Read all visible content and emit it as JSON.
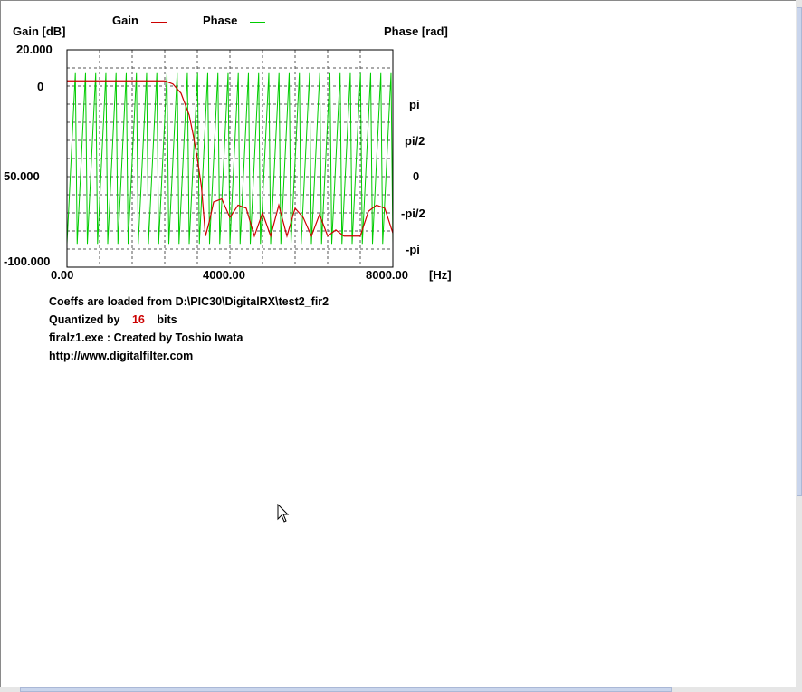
{
  "legend": {
    "gain_label": "Gain",
    "phase_label": "Phase",
    "gain_color": "#cc0000",
    "phase_color": "#00cc00"
  },
  "axes": {
    "left_title": "Gain [dB]",
    "right_title": "Phase [rad]",
    "left_ticks": [
      "20.000",
      "0",
      "50.000",
      "-100.000"
    ],
    "right_ticks": [
      "pi",
      "pi/2",
      "0",
      "-pi/2",
      "-pi"
    ],
    "x_ticks": [
      "0.00",
      "4000.00",
      "8000.00"
    ],
    "x_unit": "[Hz]"
  },
  "info": {
    "coeffs_line": "Coeffs are loaded from D:\\PIC30\\DigitalRX\\test2_fir2",
    "quantized_prefix": "Quantized by",
    "quantized_bits": "16",
    "quantized_suffix": "bits",
    "created_line": "firalz1.exe : Created by Toshio Iwata",
    "url_line": "http://www.digitalfilter.com"
  },
  "chart_data": {
    "type": "line",
    "x_range": [
      0,
      8000
    ],
    "x_unit": "Hz",
    "grid": true,
    "series": [
      {
        "name": "Gain",
        "color": "#cc0000",
        "x": [
          0,
          2400,
          2600,
          2800,
          3000,
          3100,
          3200,
          3300,
          3400,
          3500,
          3600,
          3800,
          4000,
          4200,
          4400,
          4600,
          4800,
          5000,
          5200,
          5400,
          5600,
          5800,
          6000,
          6200,
          6400,
          6600,
          6800,
          7000,
          7200,
          7400,
          7600,
          7800,
          8000
        ],
        "y": [
          0,
          0,
          -2,
          -8,
          -22,
          -35,
          -50,
          -68,
          -100,
          -90,
          -78,
          -76,
          -88,
          -80,
          -82,
          -100,
          -85,
          -100,
          -80,
          -100,
          -82,
          -88,
          -100,
          -86,
          -100,
          -96,
          -100,
          -100,
          -100,
          -84,
          -80,
          -82,
          -98
        ]
      },
      {
        "name": "Phase",
        "color": "#00cc00",
        "x_range": [
          0,
          8000
        ],
        "description_range_rad": [
          -1.571,
          1.571
        ],
        "sawtooth_cycles": 32
      }
    ]
  }
}
